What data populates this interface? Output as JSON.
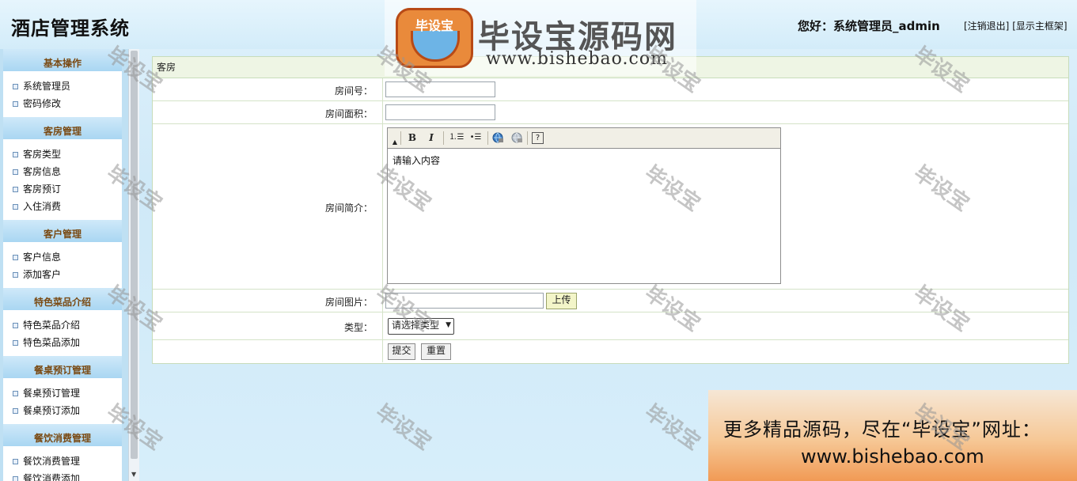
{
  "header": {
    "title": "酒店管理系统",
    "greeting": "您好：系统管理员_admin",
    "logout_link": "[注销退出]",
    "show_frame_link": "[显示主框架]"
  },
  "watermark": {
    "badge": "毕设宝",
    "name": "毕设宝源码网",
    "url": "www.bishebao.com",
    "repeat": "毕设宝"
  },
  "sidebar": {
    "sections": [
      {
        "title": "基本操作",
        "items": [
          "系统管理员",
          "密码修改"
        ]
      },
      {
        "title": "客房管理",
        "items": [
          "客房类型",
          "客房信息",
          "客房预订",
          "入住消费"
        ]
      },
      {
        "title": "客户管理",
        "items": [
          "客户信息",
          "添加客户"
        ]
      },
      {
        "title": "特色菜品介绍",
        "items": [
          "特色菜品介绍",
          "特色菜品添加"
        ]
      },
      {
        "title": "餐桌预订管理",
        "items": [
          "餐桌预订管理",
          "餐桌预订添加"
        ]
      },
      {
        "title": "餐饮消费管理",
        "items": [
          "餐饮消费管理",
          "餐饮消费添加"
        ]
      }
    ]
  },
  "form": {
    "heading": "客房",
    "room_no_label": "房间号：",
    "room_no_value": "",
    "area_label": "房间面积：",
    "area_value": "",
    "intro_label": "房间简介：",
    "intro_placeholder": "请输入内容",
    "image_label": "房间图片：",
    "image_value": "",
    "upload_label": "上传",
    "type_label": "类型：",
    "type_selected": "请选择类型",
    "submit_label": "提交",
    "reset_label": "重置"
  },
  "editor_toolbar": {
    "bold": "B",
    "italic": "I",
    "ordered_list": "⒈☰",
    "unordered_list": "•☰",
    "help": "?"
  },
  "ad": {
    "line1": "更多精品源码，尽在“毕设宝”网址：",
    "line2": "www.bishebao.com"
  }
}
